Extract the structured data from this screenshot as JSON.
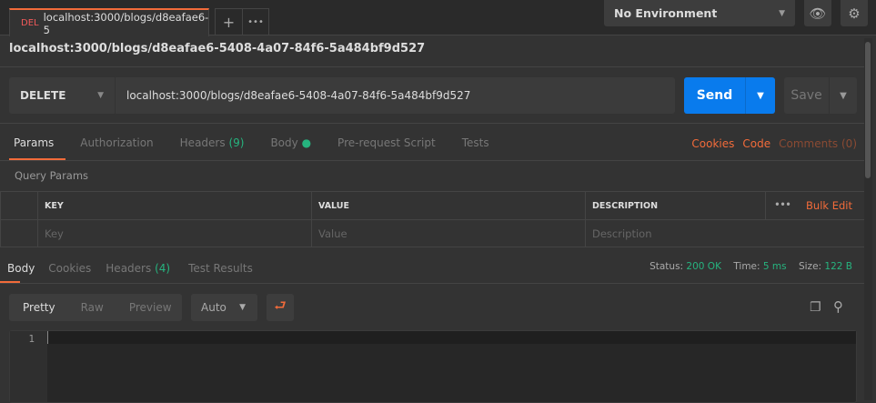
{
  "tab": {
    "method": "DEL",
    "title": "localhost:3000/blogs/d8eafae6-5",
    "add": "+",
    "more": "•••"
  },
  "environment": {
    "selected": "No Environment"
  },
  "request": {
    "title": "localhost:3000/blogs/d8eafae6-5408-4a07-84f6-5a484bf9d527",
    "method": "DELETE",
    "url": "localhost:3000/blogs/d8eafae6-5408-4a07-84f6-5a484bf9d527",
    "send": "Send",
    "save": "Save"
  },
  "req_tabs": {
    "params": "Params",
    "authorization": "Authorization",
    "headers": "Headers",
    "headers_count": "(9)",
    "body": "Body",
    "prerequest": "Pre-request Script",
    "tests": "Tests",
    "cookies": "Cookies",
    "code": "Code",
    "comments": "Comments (0)"
  },
  "query": {
    "label": "Query Params",
    "columns": [
      "KEY",
      "VALUE",
      "DESCRIPTION"
    ],
    "bulk_edit": "Bulk Edit",
    "more": "•••",
    "placeholders": [
      "Key",
      "Value",
      "Description"
    ]
  },
  "response": {
    "tabs": {
      "body": "Body",
      "cookies": "Cookies",
      "headers": "Headers",
      "headers_count": "(4)",
      "tests": "Test Results"
    },
    "status_label": "Status:",
    "status": "200 OK",
    "time_label": "Time:",
    "time": "5 ms",
    "size_label": "Size:",
    "size": "122 B",
    "views": [
      "Pretty",
      "Raw",
      "Preview"
    ],
    "format": "Auto",
    "line_number": "1"
  },
  "colors": {
    "accent": "#f26b3a",
    "send": "#097bed",
    "success": "#26b47f"
  }
}
